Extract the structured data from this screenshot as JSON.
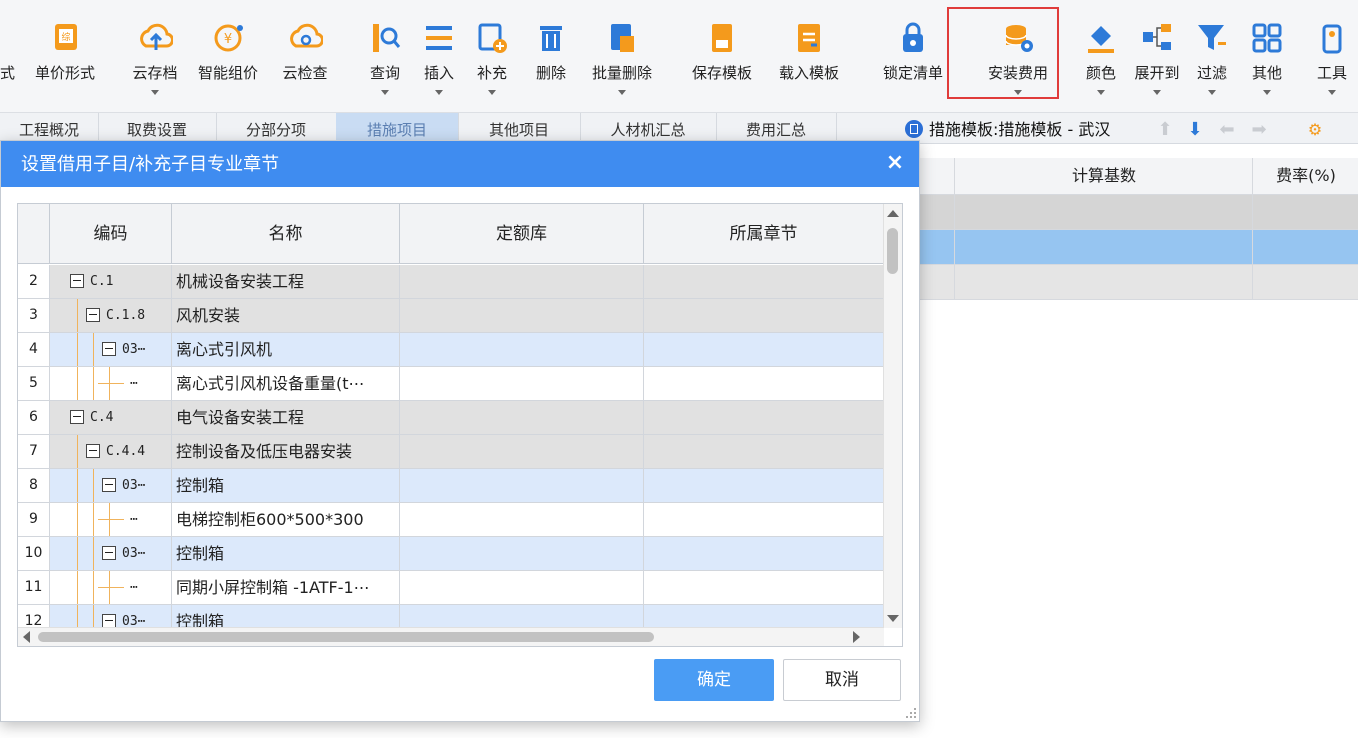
{
  "toolbar": {
    "items": [
      {
        "label": "式",
        "icon": "partial-icon",
        "caret": false
      },
      {
        "label": "单价形式",
        "icon": "price-form-icon",
        "caret": false
      },
      {
        "label": "云存档",
        "icon": "cloud-upload-icon",
        "caret": true
      },
      {
        "label": "智能组价",
        "icon": "smart-price-icon",
        "caret": false
      },
      {
        "label": "云检查",
        "icon": "cloud-check-icon",
        "caret": false
      },
      {
        "label": "查询",
        "icon": "query-icon",
        "caret": true
      },
      {
        "label": "插入",
        "icon": "insert-icon",
        "caret": true
      },
      {
        "label": "补充",
        "icon": "supplement-icon",
        "caret": true
      },
      {
        "label": "删除",
        "icon": "trash-icon",
        "caret": false
      },
      {
        "label": "批量删除",
        "icon": "batch-delete-icon",
        "caret": true
      },
      {
        "label": "保存模板",
        "icon": "save-template-icon",
        "caret": false
      },
      {
        "label": "载入模板",
        "icon": "load-template-icon",
        "caret": false
      },
      {
        "label": "锁定清单",
        "icon": "lock-icon",
        "caret": false
      },
      {
        "label": "安装费用",
        "icon": "install-cost-icon",
        "caret": true
      },
      {
        "label": "颜色",
        "icon": "color-bucket-icon",
        "caret": true
      },
      {
        "label": "展开到",
        "icon": "expand-tree-icon",
        "caret": true
      },
      {
        "label": "过滤",
        "icon": "filter-icon",
        "caret": true
      },
      {
        "label": "其他",
        "icon": "grid-apps-icon",
        "caret": true
      },
      {
        "label": "工具",
        "icon": "tools-icon",
        "caret": true
      }
    ]
  },
  "tabs": [
    {
      "label": "工程概况",
      "active": false
    },
    {
      "label": "取费设置",
      "active": false
    },
    {
      "label": "分部分项",
      "active": false
    },
    {
      "label": "措施项目",
      "active": true
    },
    {
      "label": "其他项目",
      "active": false
    },
    {
      "label": "人材机汇总",
      "active": false
    },
    {
      "label": "费用汇总",
      "active": false
    }
  ],
  "template_info": "措施模板:措施模板 - 武汉",
  "bg_grid": {
    "headers": [
      "",
      "计算基数",
      "费率(%)"
    ]
  },
  "dialog": {
    "title": "设置借用子目/补充子目专业章节",
    "close": "×",
    "columns": [
      "编码",
      "名称",
      "定额库",
      "所属章节"
    ],
    "rows": [
      {
        "num": "2",
        "code": "C.1",
        "name": "机械设备安装工程",
        "lib": "",
        "chapter": "",
        "level": 0,
        "expander": true,
        "style": "gray"
      },
      {
        "num": "3",
        "code": "C.1.8",
        "name": "风机安装",
        "lib": "",
        "chapter": "",
        "level": 1,
        "expander": true,
        "style": "gray"
      },
      {
        "num": "4",
        "code": "03⋯",
        "name": "离心式引风机",
        "lib": "",
        "chapter": "",
        "level": 2,
        "expander": true,
        "style": "blue"
      },
      {
        "num": "5",
        "code": "⋯",
        "name": "离心式引风机设备重量(t⋯",
        "lib": "",
        "chapter": "",
        "level": 3,
        "expander": false,
        "style": "white"
      },
      {
        "num": "6",
        "code": "C.4",
        "name": "电气设备安装工程",
        "lib": "",
        "chapter": "",
        "level": 0,
        "expander": true,
        "style": "gray"
      },
      {
        "num": "7",
        "code": "C.4.4",
        "name": "控制设备及低压电器安装",
        "lib": "",
        "chapter": "",
        "level": 1,
        "expander": true,
        "style": "gray"
      },
      {
        "num": "8",
        "code": "03⋯",
        "name": "控制箱",
        "lib": "",
        "chapter": "",
        "level": 2,
        "expander": true,
        "style": "blue"
      },
      {
        "num": "9",
        "code": "⋯",
        "name": "电梯控制柜600*500*300",
        "lib": "",
        "chapter": "",
        "level": 3,
        "expander": false,
        "style": "white"
      },
      {
        "num": "10",
        "code": "03⋯",
        "name": "控制箱",
        "lib": "",
        "chapter": "",
        "level": 2,
        "expander": true,
        "style": "blue"
      },
      {
        "num": "11",
        "code": "⋯",
        "name": "同期小屏控制箱 -1ATF-1⋯",
        "lib": "",
        "chapter": "",
        "level": 3,
        "expander": false,
        "style": "white"
      },
      {
        "num": "12",
        "code": "03⋯",
        "name": "控制箱",
        "lib": "",
        "chapter": "",
        "level": 2,
        "expander": true,
        "style": "blue"
      }
    ],
    "ok_label": "确定",
    "cancel_label": "取消"
  },
  "colors": {
    "title_bar": "#3f8cf0",
    "highlight": "#e03b3b",
    "icon_orange": "#f49a1c",
    "icon_blue": "#2d7ad8"
  }
}
